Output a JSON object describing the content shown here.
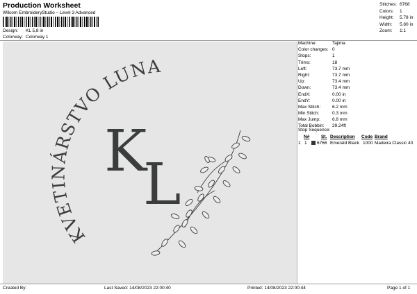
{
  "header": {
    "title": "Production Worksheet",
    "subtitle": "Wilcom EmbroideryStudio – Level 3 Advanced",
    "design_label": "Design:",
    "design_value": "KL 5,8 in",
    "colorway_label": "Colorway:",
    "colorway_value": "Colorway 1"
  },
  "stats": [
    {
      "label": "Stitches:",
      "value": "6768"
    },
    {
      "label": "Colors:",
      "value": "1"
    },
    {
      "label": "Height:",
      "value": "5.78 in"
    },
    {
      "label": "Width:",
      "value": "5.80 in"
    },
    {
      "label": "Zoom:",
      "value": "1:1"
    }
  ],
  "design_text": {
    "arc_text": "KVETINÁRSTVO LUNA",
    "monogram_1": "K",
    "monogram_2": "L"
  },
  "properties": [
    {
      "label": "Machine:",
      "value": "Tajima"
    },
    {
      "label": "Color changes:",
      "value": "0"
    },
    {
      "label": "Stops:",
      "value": "1"
    },
    {
      "label": "Trims:",
      "value": "18"
    },
    {
      "label": "Left:",
      "value": "73.7 mm"
    },
    {
      "label": "Right:",
      "value": "73.7 mm"
    },
    {
      "label": "Up:",
      "value": "73.4 mm"
    },
    {
      "label": "Down:",
      "value": "73.4 mm"
    },
    {
      "label": "EndX:",
      "value": "0.00 in"
    },
    {
      "label": "EndY:",
      "value": "0.00 in"
    },
    {
      "label": "Max Stitch:",
      "value": "6.2 mm"
    },
    {
      "label": "Min Stitch:",
      "value": "0.3 mm"
    },
    {
      "label": "Max Jump:",
      "value": "6.8 mm"
    },
    {
      "label": "Total Bobbin:",
      "value": "29.24ft"
    }
  ],
  "stop_sequence": {
    "title": "Stop Sequence:",
    "columns": [
      "N#",
      "St.",
      "Description",
      "Code",
      "Brand"
    ],
    "rows": [
      {
        "index": "1",
        "n": "1",
        "color": "#333333",
        "st": "6766",
        "description": "Emerald Black",
        "code": "1000",
        "brand": "Madeira Classic 40"
      }
    ]
  },
  "footer": {
    "created_by": "Created By:",
    "last_saved": "Last Saved: 14/08/2023 22:00:40",
    "printed": "Printed: 14/08/2023 22:00:44",
    "page": "Page 1 of 1"
  },
  "colors": {
    "canvas_bg": "#e6e6e6",
    "thread": "#3a3d3c"
  }
}
